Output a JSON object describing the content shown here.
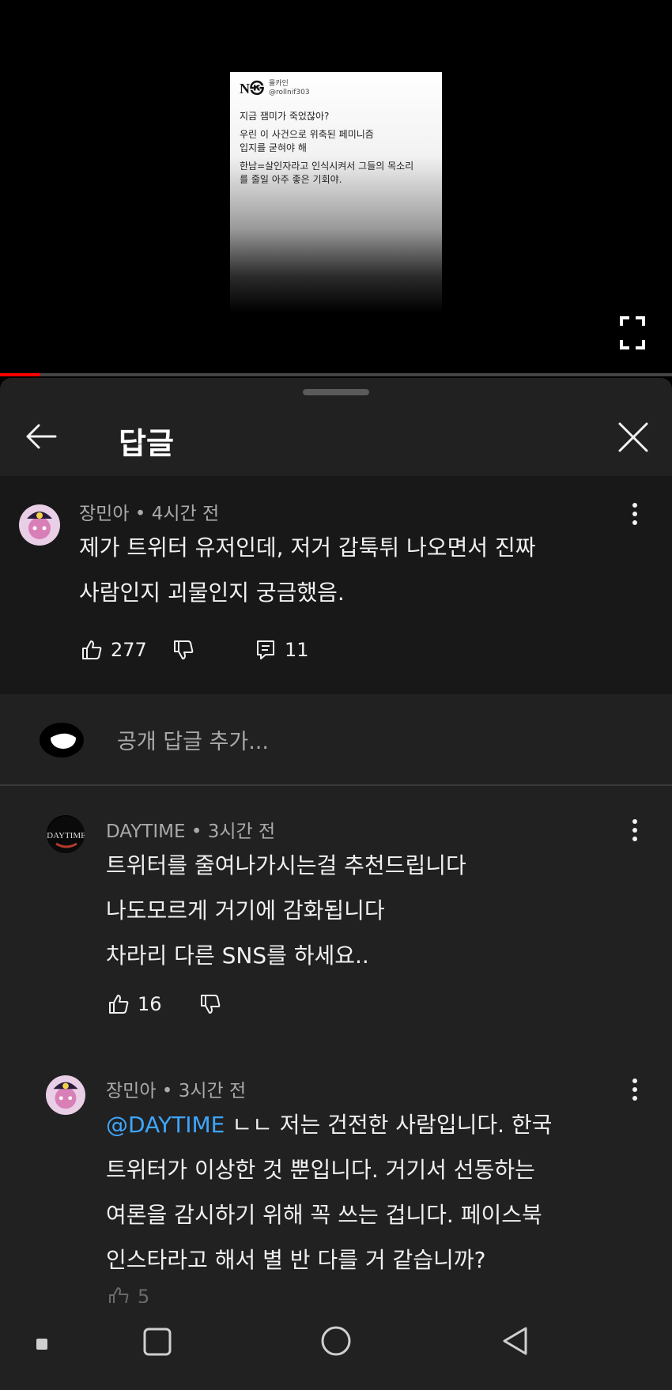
{
  "video": {
    "tweet": {
      "logo": "N㉿",
      "display_name": "몰카인",
      "handle": "@rollnif303",
      "lines": [
        "지금 잼미가 죽었잖아?",
        "우린 이 사건으로 위축된 페미니즘",
        "입지를 굳혀야 해",
        "한남=살인자라고 인식시켜서 그들의 목소리",
        "를 줄일 아주 좋은 기회야."
      ]
    },
    "progress_fraction": 0.06,
    "progress_color": "#ff0000"
  },
  "sheet": {
    "title": "답글"
  },
  "main_comment": {
    "author": "장민아",
    "time": "4시간 전",
    "text": "제가 트위터 유저인데, 저거 갑툭튀 나오면서 진짜\n사람인지 괴물인지 궁금했음.",
    "likes": "277",
    "replies": "11"
  },
  "reply_input": {
    "placeholder": "공개 답글 추가..."
  },
  "replies": [
    {
      "author": "DAYTIME",
      "time": "3시간 전",
      "text": "트위터를 줄여나가시는걸 추천드립니다\n나도모르게 거기에 감화됩니다\n차라리 다른 SNS를 하세요..",
      "likes": "16"
    },
    {
      "author": "장민아",
      "time": "3시간 전",
      "mention": "@DAYTIME",
      "text_first": " ㄴㄴ 저는 건전한 사람입니다. 한국",
      "text_rest": "트위터가 이상한 것 뿐입니다. 거기서 선동하는\n여론을 감시하기 위해 꼭 쓰는 겁니다. 페이스북\n인스타라고 해서 별 반 다를 거 같습니까?",
      "likes": "5"
    }
  ],
  "separator": " • ",
  "colors": {
    "accent_mention": "#3ea6ff",
    "sheet_bg": "#212121",
    "highlight_bg": "#181818"
  }
}
